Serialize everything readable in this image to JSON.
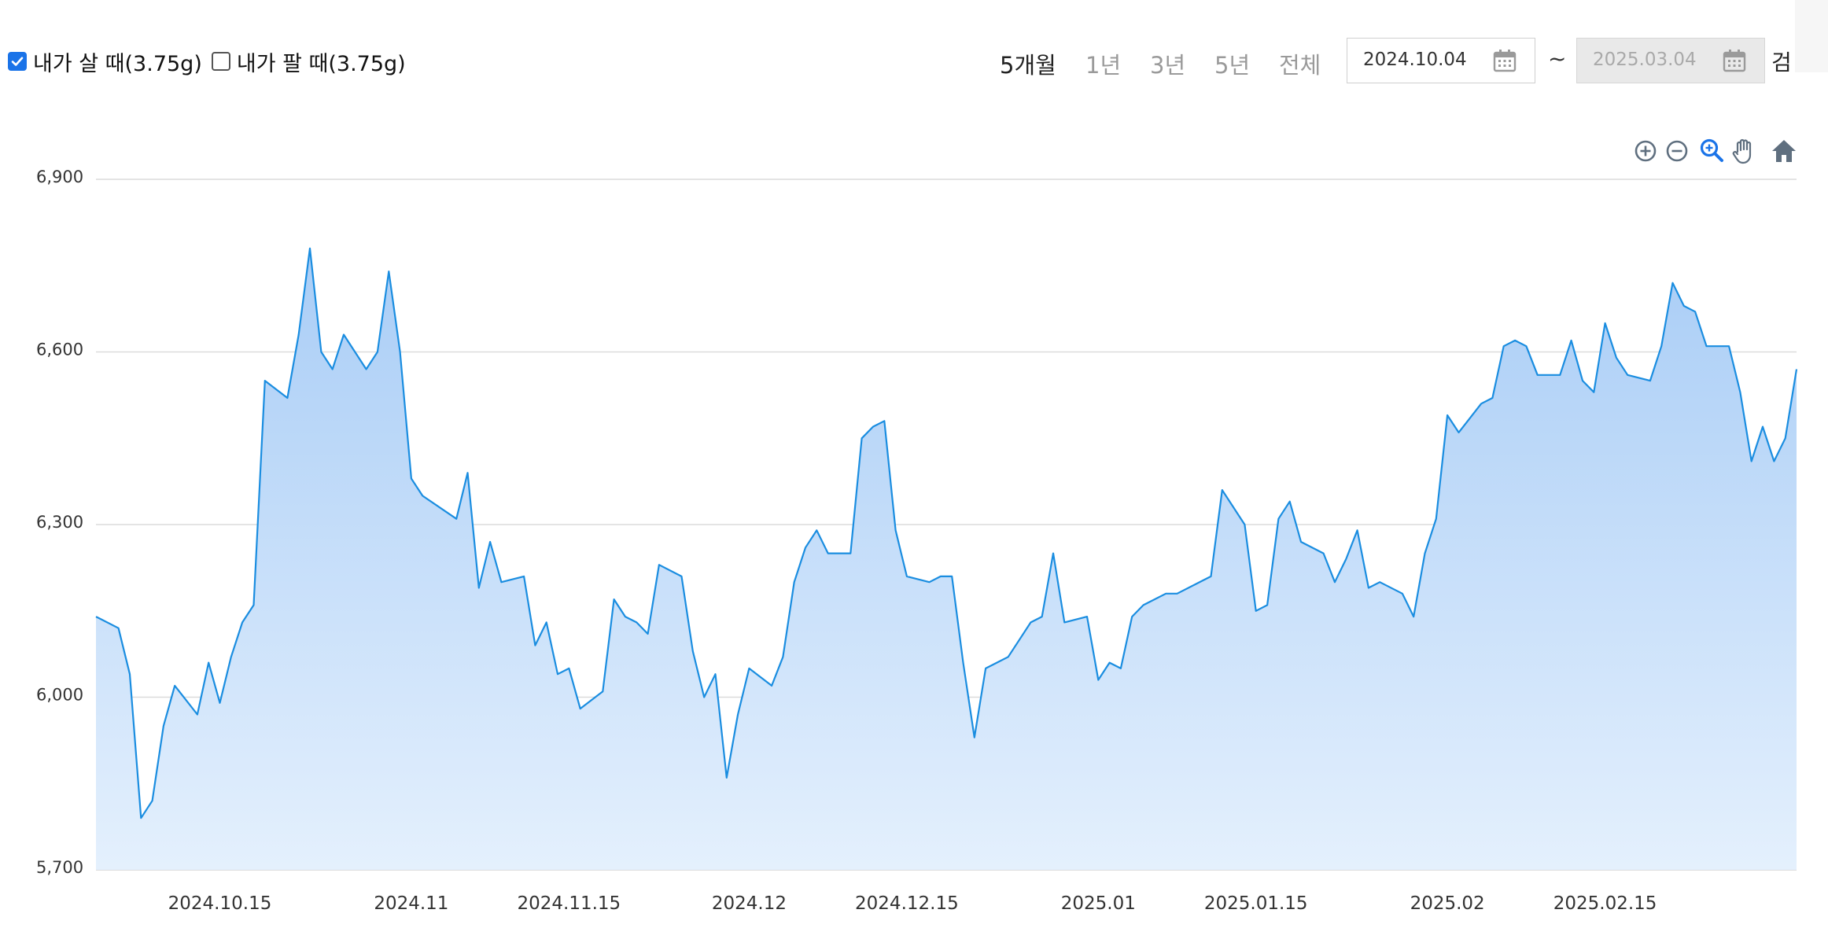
{
  "filters": [
    {
      "label": "내가 살 때(3.75g)",
      "checked": true
    },
    {
      "label": "내가 팔 때(3.75g)",
      "checked": false
    }
  ],
  "periods": [
    "5개월",
    "1년",
    "3년",
    "5년",
    "전체"
  ],
  "active_period": "5개월",
  "date_range": {
    "start": "2024.10.04",
    "end": "2025.03.04",
    "separator": "~"
  },
  "search_label": "검",
  "toolbar_icons": [
    "zoom-in-icon",
    "zoom-out-icon",
    "magnify-icon",
    "pan-hand-icon",
    "home-icon"
  ],
  "colors": {
    "line": "#1a8de0",
    "fill_top": "#a9cdf6",
    "fill_bottom": "#e4f0fd",
    "grid": "#dcdcdc",
    "accent": "#1a73e8"
  },
  "chart_data": {
    "type": "area",
    "title": "",
    "xlabel": "",
    "ylabel": "",
    "ylim": [
      5700,
      6900
    ],
    "yticks": [
      5700,
      6000,
      6300,
      6600,
      6900
    ],
    "ytick_labels": [
      "5,700",
      "6,000",
      "6,300",
      "6,600",
      "6,900"
    ],
    "xlim": [
      "2024-10-04",
      "2025-03-04"
    ],
    "xticks": [
      "2024-10-15",
      "2024-11-01",
      "2024-11-15",
      "2024-12-01",
      "2024-12-15",
      "2025-01-01",
      "2025-01-15",
      "2025-02-01",
      "2025-02-15"
    ],
    "xtick_labels": [
      "2024.10.15",
      "2024.11",
      "2024.11.15",
      "2024.12",
      "2024.12.15",
      "2025.01",
      "2025.01.15",
      "2025.02",
      "2025.02.15"
    ],
    "grid": true,
    "series": [
      {
        "points": [
          [
            "2024-10-04",
            6140
          ],
          [
            "2024-10-06",
            6120
          ],
          [
            "2024-10-07",
            6040
          ],
          [
            "2024-10-08",
            5790
          ],
          [
            "2024-10-09",
            5820
          ],
          [
            "2024-10-10",
            5950
          ],
          [
            "2024-10-11",
            6020
          ],
          [
            "2024-10-13",
            5970
          ],
          [
            "2024-10-14",
            6060
          ],
          [
            "2024-10-15",
            5990
          ],
          [
            "2024-10-16",
            6070
          ],
          [
            "2024-10-17",
            6130
          ],
          [
            "2024-10-18",
            6160
          ],
          [
            "2024-10-19",
            6550
          ],
          [
            "2024-10-21",
            6520
          ],
          [
            "2024-10-22",
            6630
          ],
          [
            "2024-10-23",
            6780
          ],
          [
            "2024-10-24",
            6600
          ],
          [
            "2024-10-25",
            6570
          ],
          [
            "2024-10-26",
            6630
          ],
          [
            "2024-10-28",
            6570
          ],
          [
            "2024-10-29",
            6600
          ],
          [
            "2024-10-30",
            6740
          ],
          [
            "2024-10-31",
            6600
          ],
          [
            "2024-11-01",
            6380
          ],
          [
            "2024-11-02",
            6350
          ],
          [
            "2024-11-05",
            6310
          ],
          [
            "2024-11-06",
            6390
          ],
          [
            "2024-11-07",
            6190
          ],
          [
            "2024-11-08",
            6270
          ],
          [
            "2024-11-09",
            6200
          ],
          [
            "2024-11-11",
            6210
          ],
          [
            "2024-11-12",
            6090
          ],
          [
            "2024-11-13",
            6130
          ],
          [
            "2024-11-14",
            6040
          ],
          [
            "2024-11-15",
            6050
          ],
          [
            "2024-11-16",
            5980
          ],
          [
            "2024-11-18",
            6010
          ],
          [
            "2024-11-19",
            6170
          ],
          [
            "2024-11-20",
            6140
          ],
          [
            "2024-11-21",
            6130
          ],
          [
            "2024-11-22",
            6110
          ],
          [
            "2024-11-23",
            6230
          ],
          [
            "2024-11-25",
            6210
          ],
          [
            "2024-11-26",
            6080
          ],
          [
            "2024-11-27",
            6000
          ],
          [
            "2024-11-28",
            6040
          ],
          [
            "2024-11-29",
            5860
          ],
          [
            "2024-11-30",
            5970
          ],
          [
            "2024-12-01",
            6050
          ],
          [
            "2024-12-03",
            6020
          ],
          [
            "2024-12-04",
            6070
          ],
          [
            "2024-12-05",
            6200
          ],
          [
            "2024-12-06",
            6260
          ],
          [
            "2024-12-07",
            6290
          ],
          [
            "2024-12-08",
            6250
          ],
          [
            "2024-12-10",
            6250
          ],
          [
            "2024-12-11",
            6450
          ],
          [
            "2024-12-12",
            6470
          ],
          [
            "2024-12-13",
            6480
          ],
          [
            "2024-12-14",
            6290
          ],
          [
            "2024-12-15",
            6210
          ],
          [
            "2024-12-17",
            6200
          ],
          [
            "2024-12-18",
            6210
          ],
          [
            "2024-12-19",
            6210
          ],
          [
            "2024-12-20",
            6060
          ],
          [
            "2024-12-21",
            5930
          ],
          [
            "2024-12-22",
            6050
          ],
          [
            "2024-12-24",
            6070
          ],
          [
            "2024-12-25",
            6100
          ],
          [
            "2024-12-26",
            6130
          ],
          [
            "2024-12-27",
            6140
          ],
          [
            "2024-12-28",
            6250
          ],
          [
            "2024-12-29",
            6130
          ],
          [
            "2024-12-31",
            6140
          ],
          [
            "2025-01-01",
            6030
          ],
          [
            "2025-01-02",
            6060
          ],
          [
            "2025-01-03",
            6050
          ],
          [
            "2025-01-04",
            6140
          ],
          [
            "2025-01-05",
            6160
          ],
          [
            "2025-01-07",
            6180
          ],
          [
            "2025-01-08",
            6180
          ],
          [
            "2025-01-11",
            6210
          ],
          [
            "2025-01-12",
            6360
          ],
          [
            "2025-01-14",
            6300
          ],
          [
            "2025-01-15",
            6150
          ],
          [
            "2025-01-16",
            6160
          ],
          [
            "2025-01-17",
            6310
          ],
          [
            "2025-01-18",
            6340
          ],
          [
            "2025-01-19",
            6270
          ],
          [
            "2025-01-21",
            6250
          ],
          [
            "2025-01-22",
            6200
          ],
          [
            "2025-01-23",
            6240
          ],
          [
            "2025-01-24",
            6290
          ],
          [
            "2025-01-25",
            6190
          ],
          [
            "2025-01-26",
            6200
          ],
          [
            "2025-01-28",
            6180
          ],
          [
            "2025-01-29",
            6140
          ],
          [
            "2025-01-30",
            6250
          ],
          [
            "2025-01-31",
            6310
          ],
          [
            "2025-02-01",
            6490
          ],
          [
            "2025-02-02",
            6460
          ],
          [
            "2025-02-04",
            6510
          ],
          [
            "2025-02-05",
            6520
          ],
          [
            "2025-02-06",
            6610
          ],
          [
            "2025-02-07",
            6620
          ],
          [
            "2025-02-08",
            6610
          ],
          [
            "2025-02-09",
            6560
          ],
          [
            "2025-02-11",
            6560
          ],
          [
            "2025-02-12",
            6620
          ],
          [
            "2025-02-13",
            6550
          ],
          [
            "2025-02-14",
            6530
          ],
          [
            "2025-02-15",
            6650
          ],
          [
            "2025-02-16",
            6590
          ],
          [
            "2025-02-17",
            6560
          ],
          [
            "2025-02-19",
            6550
          ],
          [
            "2025-02-20",
            6610
          ],
          [
            "2025-02-21",
            6720
          ],
          [
            "2025-02-22",
            6680
          ],
          [
            "2025-02-23",
            6670
          ],
          [
            "2025-02-24",
            6610
          ],
          [
            "2025-02-26",
            6610
          ],
          [
            "2025-02-27",
            6530
          ],
          [
            "2025-02-28",
            6410
          ],
          [
            "2025-03-01",
            6470
          ],
          [
            "2025-03-02",
            6410
          ],
          [
            "2025-03-03",
            6450
          ],
          [
            "2025-03-04",
            6570
          ]
        ]
      }
    ]
  }
}
